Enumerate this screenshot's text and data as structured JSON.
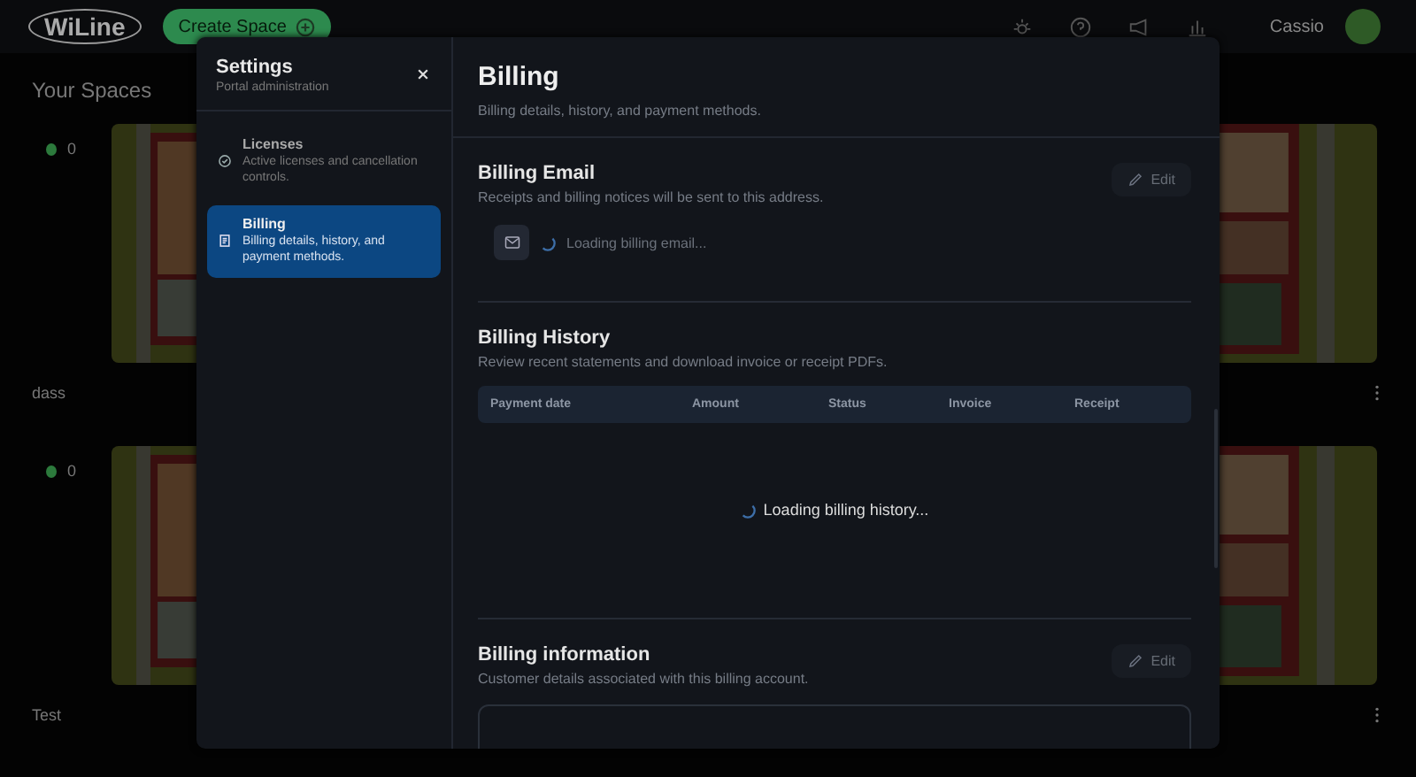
{
  "header": {
    "logo": "WiLine",
    "create_button": "Create Space",
    "user_name": "Cassio"
  },
  "page_title": "Your Spaces",
  "spaces": [
    {
      "name": "dass",
      "online_count": "0",
      "online": true
    },
    {
      "name": "Test",
      "online_count": "0",
      "online": true
    }
  ],
  "settings": {
    "title": "Settings",
    "subtitle": "Portal administration",
    "nav": [
      {
        "kind": "licenses",
        "label": "Licenses",
        "description": "Active licenses and cancellation controls.",
        "selected": false
      },
      {
        "kind": "billing",
        "label": "Billing",
        "description": "Billing details, history, and payment methods.",
        "selected": true
      }
    ],
    "page": {
      "title": "Billing",
      "subtitle": "Billing details, history, and payment methods.",
      "billing_email": {
        "title": "Billing Email",
        "description": "Receipts and billing notices will be sent to this address.",
        "edit_button": "Edit",
        "loading": "Loading billing email..."
      },
      "billing_history": {
        "title": "Billing History",
        "description": "Review recent statements and download invoice or receipt PDFs.",
        "columns": [
          "Payment date",
          "Amount",
          "Status",
          "Invoice",
          "Receipt"
        ],
        "loading": "Loading billing history..."
      },
      "billing_information": {
        "title": "Billing information",
        "description": "Customer details associated with this billing account.",
        "edit_button": "Edit"
      }
    }
  }
}
